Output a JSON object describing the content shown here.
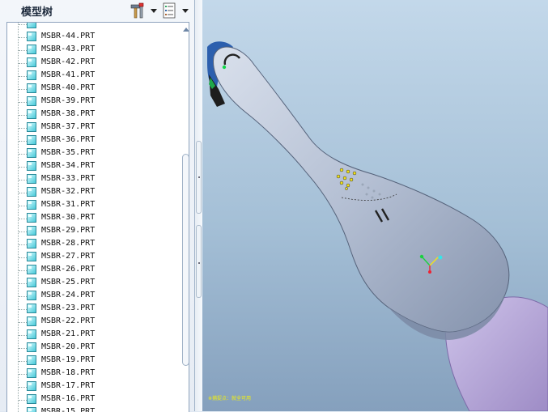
{
  "panel": {
    "title": "模型树",
    "settings_icon": "hammer-settings-icon",
    "show_icon": "tree-list-icon"
  },
  "tree": {
    "items": [
      {
        "label": ""
      },
      {
        "label": "MSBR-44.PRT"
      },
      {
        "label": "MSBR-43.PRT"
      },
      {
        "label": "MSBR-42.PRT"
      },
      {
        "label": "MSBR-41.PRT"
      },
      {
        "label": "MSBR-40.PRT"
      },
      {
        "label": "MSBR-39.PRT"
      },
      {
        "label": "MSBR-38.PRT"
      },
      {
        "label": "MSBR-37.PRT"
      },
      {
        "label": "MSBR-36.PRT"
      },
      {
        "label": "MSBR-35.PRT"
      },
      {
        "label": "MSBR-34.PRT"
      },
      {
        "label": "MSBR-33.PRT"
      },
      {
        "label": "MSBR-32.PRT"
      },
      {
        "label": "MSBR-31.PRT"
      },
      {
        "label": "MSBR-30.PRT"
      },
      {
        "label": "MSBR-29.PRT"
      },
      {
        "label": "MSBR-28.PRT"
      },
      {
        "label": "MSBR-27.PRT"
      },
      {
        "label": "MSBR-26.PRT"
      },
      {
        "label": "MSBR-25.PRT"
      },
      {
        "label": "MSBR-24.PRT"
      },
      {
        "label": "MSBR-23.PRT"
      },
      {
        "label": "MSBR-22.PRT"
      },
      {
        "label": "MSBR-21.PRT"
      },
      {
        "label": "MSBR-20.PRT"
      },
      {
        "label": "MSBR-19.PRT"
      },
      {
        "label": "MSBR-18.PRT"
      },
      {
        "label": "MSBR-17.PRT"
      },
      {
        "label": "MSBR-16.PRT"
      },
      {
        "label": "MSBR-15.PRT"
      }
    ],
    "item_icon": "part-file-icon"
  },
  "viewport": {
    "status_text": "※捕捉点：就全可用",
    "model": "electric-toothbrush-handle-model",
    "colors": {
      "body": "#b9c3d6",
      "sleeve": "#b6a6d8",
      "background_top": "#c3d8ea",
      "background_bottom": "#85a0bd"
    }
  }
}
